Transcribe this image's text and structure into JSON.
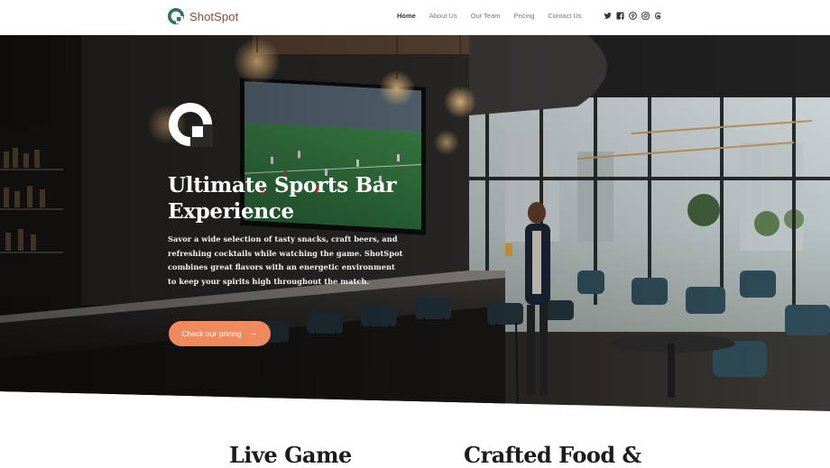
{
  "header": {
    "brand": "ShotSpot",
    "nav": [
      "Home",
      "About Us",
      "Our Team",
      "Pricing",
      "Contact Us"
    ],
    "active_nav": "Home",
    "socials": [
      "twitter-icon",
      "facebook-icon",
      "pinterest-icon",
      "instagram-icon",
      "threads-icon"
    ]
  },
  "hero": {
    "title": "Ultimate Sports Bar Experience",
    "description": "Savor a wide selection of tasty snacks, craft beers, and refreshing cocktails while watching the game. ShotSpot combines great flavors with an energetic environment to keep your spirits high throughout the match.",
    "cta_label": "Check our pricing",
    "cta_arrow": "→"
  },
  "features": {
    "left_title": "Live Game",
    "right_title": "Crafted Food &"
  },
  "colors": {
    "accent": "#f08a5d",
    "brand_text": "#8a4a3a",
    "logo_teal": "#2f6f73"
  }
}
